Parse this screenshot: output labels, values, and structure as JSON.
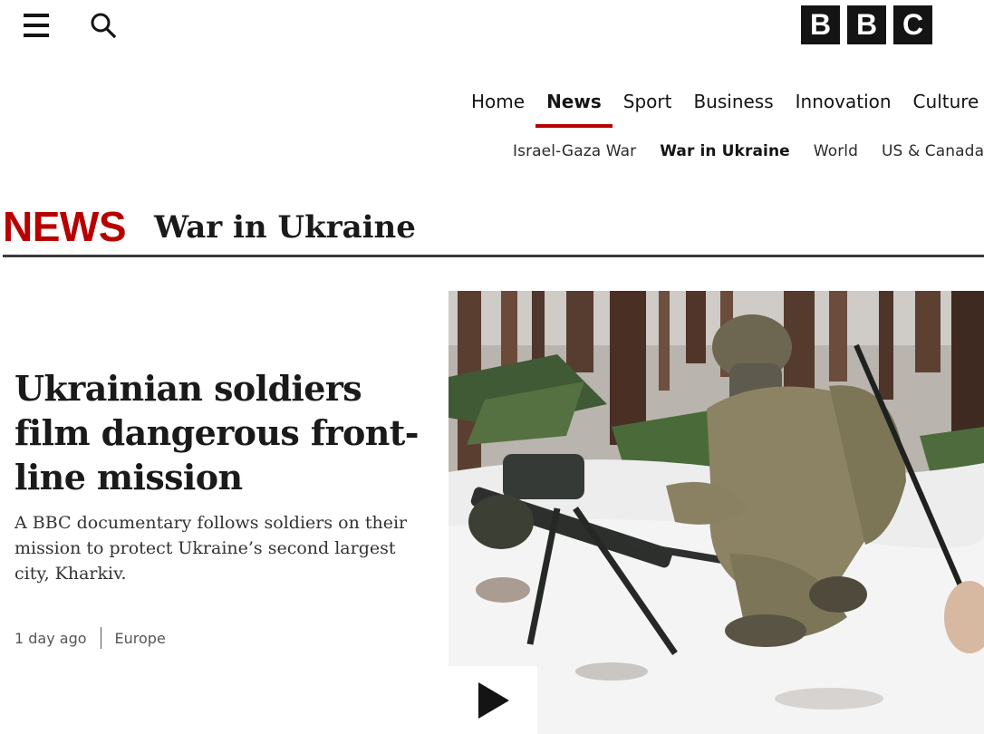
{
  "header": {
    "menu_icon": "hamburger-menu-icon",
    "search_icon": "search-icon",
    "logo_letters": [
      "B",
      "B",
      "C"
    ]
  },
  "primary_nav": {
    "items": [
      {
        "label": "Home",
        "active": false
      },
      {
        "label": "News",
        "active": true
      },
      {
        "label": "Sport",
        "active": false
      },
      {
        "label": "Business",
        "active": false
      },
      {
        "label": "Innovation",
        "active": false
      },
      {
        "label": "Culture",
        "active": false
      }
    ]
  },
  "secondary_nav": {
    "items": [
      {
        "label": "Israel-Gaza War",
        "active": false
      },
      {
        "label": "War in Ukraine",
        "active": true
      },
      {
        "label": "World",
        "active": false
      },
      {
        "label": "US & Canada",
        "active": false
      }
    ]
  },
  "section": {
    "brand": "NEWS",
    "title": "War in Ukraine"
  },
  "story": {
    "headline": "Ukrainian soldiers film dangerous front-line mission",
    "summary": "A BBC documentary follows soldiers on their mission to protect Ukraine’s second largest city, Kharkiv.",
    "time": "1 day ago",
    "category": "Europe",
    "play_icon": "play-icon"
  },
  "colors": {
    "brand_red": "#b80000",
    "text": "#141414",
    "logo_bg": "#141414"
  }
}
